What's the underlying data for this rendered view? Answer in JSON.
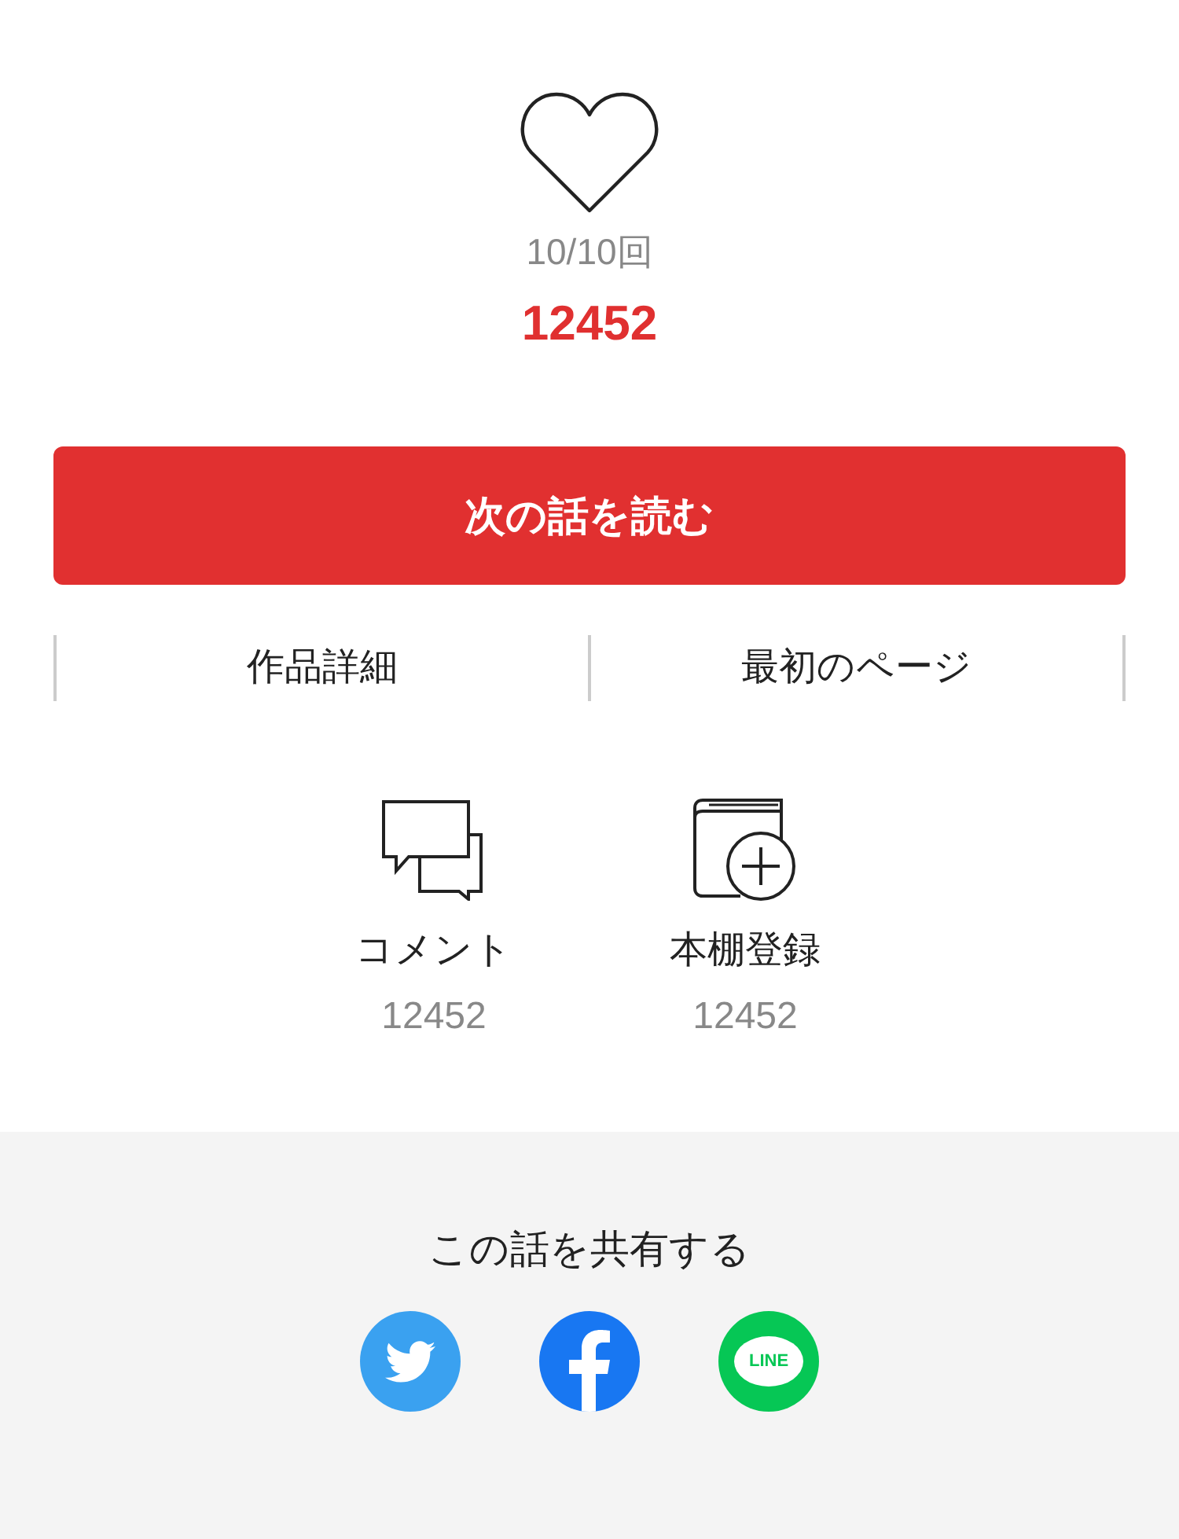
{
  "like": {
    "liked": false,
    "remaining": "10/10回",
    "count": "12452"
  },
  "next_button": "次の話を読む",
  "links": [
    {
      "label": "作品詳細"
    },
    {
      "label": "最初のページ"
    }
  ],
  "actions": [
    {
      "kind": "comment",
      "label": "コメント",
      "count": "12452"
    },
    {
      "kind": "bookshelf",
      "label": "本棚登録",
      "count": "12452"
    }
  ],
  "share": {
    "title": "この話を共有する",
    "buttons": [
      {
        "kind": "twitter"
      },
      {
        "kind": "facebook"
      },
      {
        "kind": "line",
        "label": "LINE"
      }
    ]
  }
}
